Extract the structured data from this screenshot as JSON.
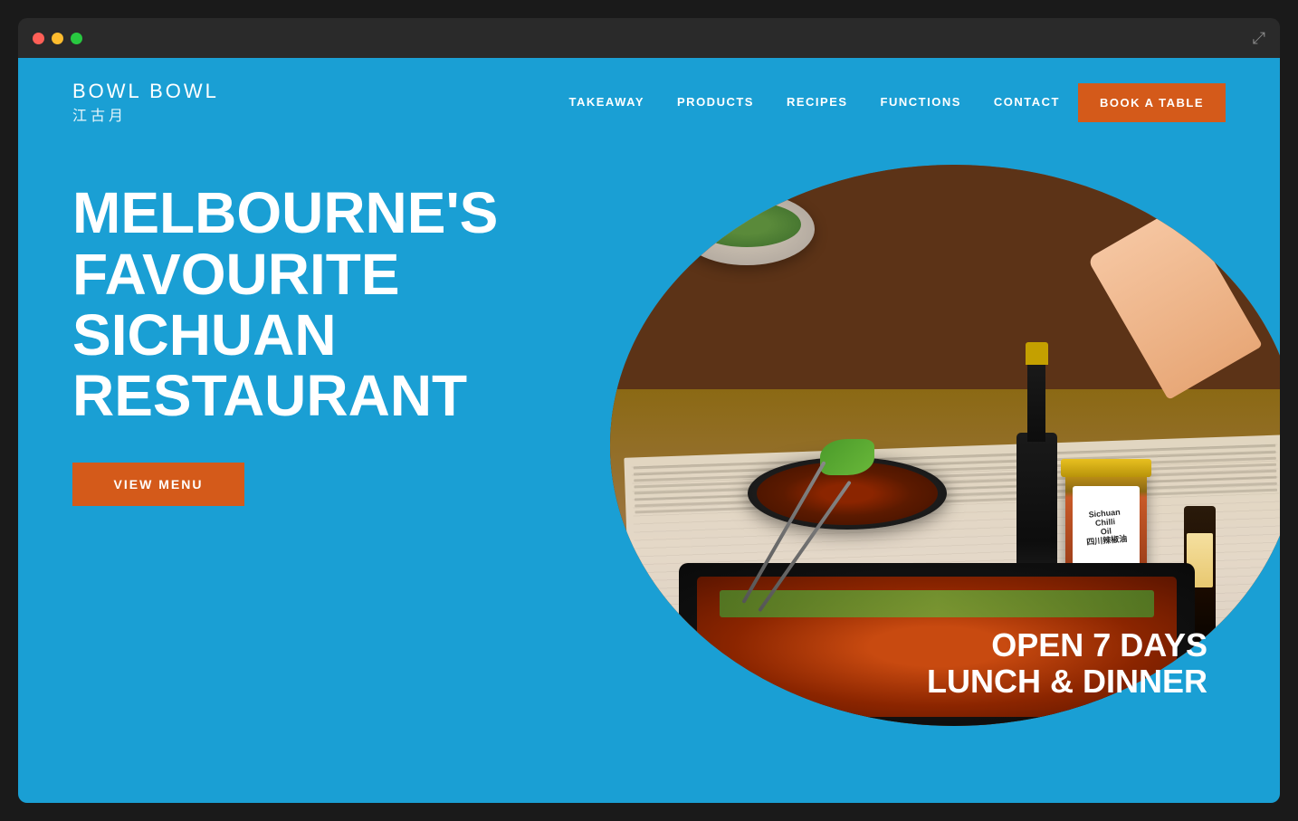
{
  "browser": {
    "close_btn": "close",
    "minimize_btn": "minimize",
    "maximize_btn": "maximize",
    "expand_icon": "⤢"
  },
  "nav": {
    "logo_main": "BOWL BOWL",
    "logo_sub": "江古月",
    "links": [
      {
        "id": "takeaway",
        "label": "TAKEAWAY"
      },
      {
        "id": "products",
        "label": "PRODUCTS"
      },
      {
        "id": "recipes",
        "label": "RECIPES"
      },
      {
        "id": "functions",
        "label": "FUNCTIONS"
      },
      {
        "id": "contact",
        "label": "CONTACT"
      }
    ],
    "cta_label": "BOOK A TABLE"
  },
  "hero": {
    "headline_line1": "MELBOURNE'S",
    "headline_line2": "FAVOURITE SICHUAN",
    "headline_line3": "RESTAURANT",
    "view_menu_label": "VIEW MENU",
    "open_days": "OPEN 7 DAYS",
    "open_hours": "LUNCH & DINNER"
  },
  "colors": {
    "bg_blue": "#1a9fd4",
    "accent_orange": "#d45a1a",
    "white": "#ffffff"
  }
}
